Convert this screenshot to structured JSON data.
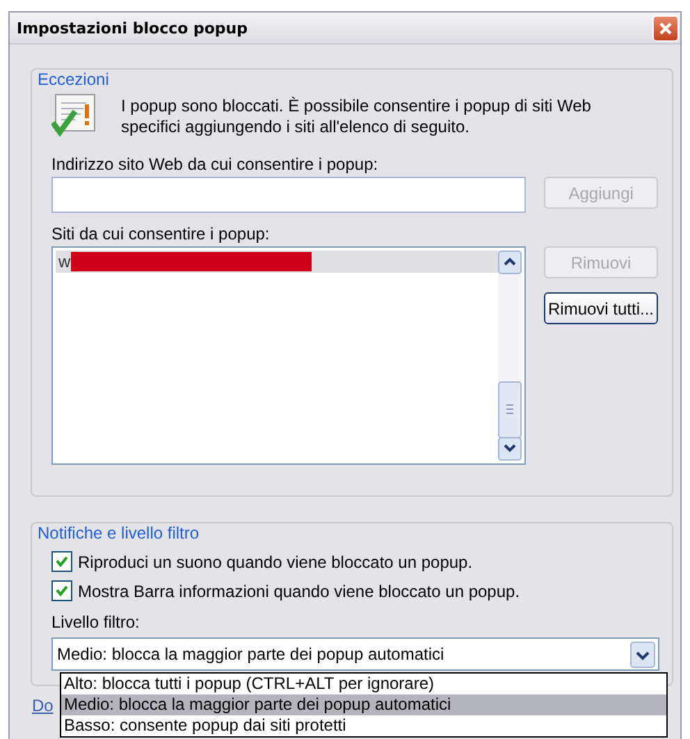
{
  "window": {
    "title": "Impostazioni blocco popup"
  },
  "exceptions": {
    "legend": "Eccezioni",
    "message": "I popup sono bloccati. È possibile consentire i popup di siti Web specifici aggiungendo i siti all'elenco di seguito.",
    "address_label": "Indirizzo sito Web da cui consentire i popup:",
    "add_button": {
      "label": "Aggiungi",
      "disabled": true
    },
    "sites_label": "Siti da cui consentire i popup:",
    "sites": [
      {
        "text": "w",
        "selected": true,
        "redacted": true
      }
    ],
    "remove_button": {
      "label": "Rimuovi",
      "disabled": true
    },
    "remove_all_button": {
      "label": "Rimuovi tutti...",
      "disabled": false
    }
  },
  "notifications": {
    "legend": "Notifiche e livello filtro",
    "options": [
      {
        "label": "Riproduci un suono quando viene bloccato un popup.",
        "checked": true
      },
      {
        "label": "Mostra Barra informazioni quando viene bloccato un popup.",
        "checked": true
      }
    ],
    "filter_label": "Livello filtro:",
    "filter_value": "Medio: blocca la maggior parte dei popup automatici",
    "expanded": true,
    "filter_options": [
      {
        "label": "Alto: blocca tutti i popup (CTRL+ALT per ignorare)",
        "selected": false
      },
      {
        "label": "Medio: blocca la maggior parte dei popup automatici",
        "selected": true
      },
      {
        "label": "Basso: consente popup dai siti protetti",
        "selected": false
      }
    ]
  },
  "footer_link": "Do"
}
